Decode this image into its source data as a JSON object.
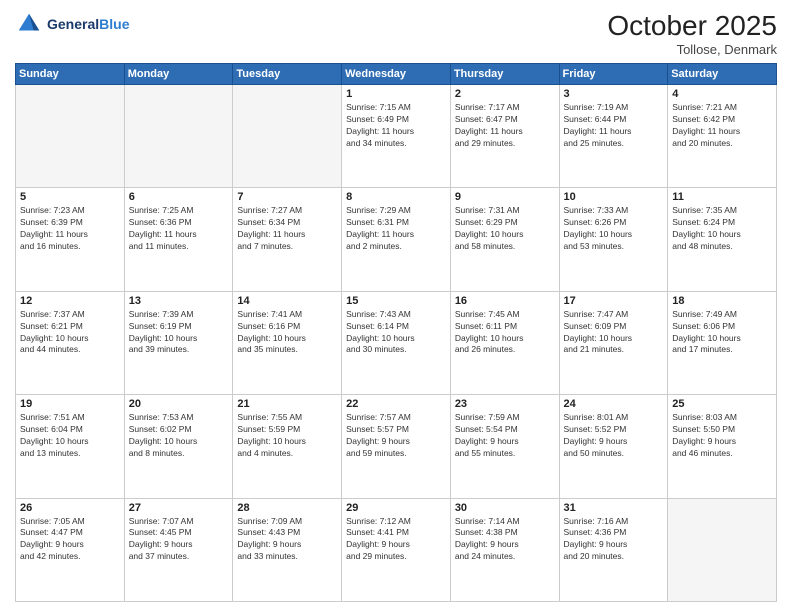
{
  "header": {
    "logo_line1": "General",
    "logo_line2": "Blue",
    "month_title": "October 2025",
    "location": "Tollose, Denmark"
  },
  "weekdays": [
    "Sunday",
    "Monday",
    "Tuesday",
    "Wednesday",
    "Thursday",
    "Friday",
    "Saturday"
  ],
  "weeks": [
    [
      {
        "day": "",
        "info": ""
      },
      {
        "day": "",
        "info": ""
      },
      {
        "day": "",
        "info": ""
      },
      {
        "day": "1",
        "info": "Sunrise: 7:15 AM\nSunset: 6:49 PM\nDaylight: 11 hours\nand 34 minutes."
      },
      {
        "day": "2",
        "info": "Sunrise: 7:17 AM\nSunset: 6:47 PM\nDaylight: 11 hours\nand 29 minutes."
      },
      {
        "day": "3",
        "info": "Sunrise: 7:19 AM\nSunset: 6:44 PM\nDaylight: 11 hours\nand 25 minutes."
      },
      {
        "day": "4",
        "info": "Sunrise: 7:21 AM\nSunset: 6:42 PM\nDaylight: 11 hours\nand 20 minutes."
      }
    ],
    [
      {
        "day": "5",
        "info": "Sunrise: 7:23 AM\nSunset: 6:39 PM\nDaylight: 11 hours\nand 16 minutes."
      },
      {
        "day": "6",
        "info": "Sunrise: 7:25 AM\nSunset: 6:36 PM\nDaylight: 11 hours\nand 11 minutes."
      },
      {
        "day": "7",
        "info": "Sunrise: 7:27 AM\nSunset: 6:34 PM\nDaylight: 11 hours\nand 7 minutes."
      },
      {
        "day": "8",
        "info": "Sunrise: 7:29 AM\nSunset: 6:31 PM\nDaylight: 11 hours\nand 2 minutes."
      },
      {
        "day": "9",
        "info": "Sunrise: 7:31 AM\nSunset: 6:29 PM\nDaylight: 10 hours\nand 58 minutes."
      },
      {
        "day": "10",
        "info": "Sunrise: 7:33 AM\nSunset: 6:26 PM\nDaylight: 10 hours\nand 53 minutes."
      },
      {
        "day": "11",
        "info": "Sunrise: 7:35 AM\nSunset: 6:24 PM\nDaylight: 10 hours\nand 48 minutes."
      }
    ],
    [
      {
        "day": "12",
        "info": "Sunrise: 7:37 AM\nSunset: 6:21 PM\nDaylight: 10 hours\nand 44 minutes."
      },
      {
        "day": "13",
        "info": "Sunrise: 7:39 AM\nSunset: 6:19 PM\nDaylight: 10 hours\nand 39 minutes."
      },
      {
        "day": "14",
        "info": "Sunrise: 7:41 AM\nSunset: 6:16 PM\nDaylight: 10 hours\nand 35 minutes."
      },
      {
        "day": "15",
        "info": "Sunrise: 7:43 AM\nSunset: 6:14 PM\nDaylight: 10 hours\nand 30 minutes."
      },
      {
        "day": "16",
        "info": "Sunrise: 7:45 AM\nSunset: 6:11 PM\nDaylight: 10 hours\nand 26 minutes."
      },
      {
        "day": "17",
        "info": "Sunrise: 7:47 AM\nSunset: 6:09 PM\nDaylight: 10 hours\nand 21 minutes."
      },
      {
        "day": "18",
        "info": "Sunrise: 7:49 AM\nSunset: 6:06 PM\nDaylight: 10 hours\nand 17 minutes."
      }
    ],
    [
      {
        "day": "19",
        "info": "Sunrise: 7:51 AM\nSunset: 6:04 PM\nDaylight: 10 hours\nand 13 minutes."
      },
      {
        "day": "20",
        "info": "Sunrise: 7:53 AM\nSunset: 6:02 PM\nDaylight: 10 hours\nand 8 minutes."
      },
      {
        "day": "21",
        "info": "Sunrise: 7:55 AM\nSunset: 5:59 PM\nDaylight: 10 hours\nand 4 minutes."
      },
      {
        "day": "22",
        "info": "Sunrise: 7:57 AM\nSunset: 5:57 PM\nDaylight: 9 hours\nand 59 minutes."
      },
      {
        "day": "23",
        "info": "Sunrise: 7:59 AM\nSunset: 5:54 PM\nDaylight: 9 hours\nand 55 minutes."
      },
      {
        "day": "24",
        "info": "Sunrise: 8:01 AM\nSunset: 5:52 PM\nDaylight: 9 hours\nand 50 minutes."
      },
      {
        "day": "25",
        "info": "Sunrise: 8:03 AM\nSunset: 5:50 PM\nDaylight: 9 hours\nand 46 minutes."
      }
    ],
    [
      {
        "day": "26",
        "info": "Sunrise: 7:05 AM\nSunset: 4:47 PM\nDaylight: 9 hours\nand 42 minutes."
      },
      {
        "day": "27",
        "info": "Sunrise: 7:07 AM\nSunset: 4:45 PM\nDaylight: 9 hours\nand 37 minutes."
      },
      {
        "day": "28",
        "info": "Sunrise: 7:09 AM\nSunset: 4:43 PM\nDaylight: 9 hours\nand 33 minutes."
      },
      {
        "day": "29",
        "info": "Sunrise: 7:12 AM\nSunset: 4:41 PM\nDaylight: 9 hours\nand 29 minutes."
      },
      {
        "day": "30",
        "info": "Sunrise: 7:14 AM\nSunset: 4:38 PM\nDaylight: 9 hours\nand 24 minutes."
      },
      {
        "day": "31",
        "info": "Sunrise: 7:16 AM\nSunset: 4:36 PM\nDaylight: 9 hours\nand 20 minutes."
      },
      {
        "day": "",
        "info": ""
      }
    ]
  ]
}
